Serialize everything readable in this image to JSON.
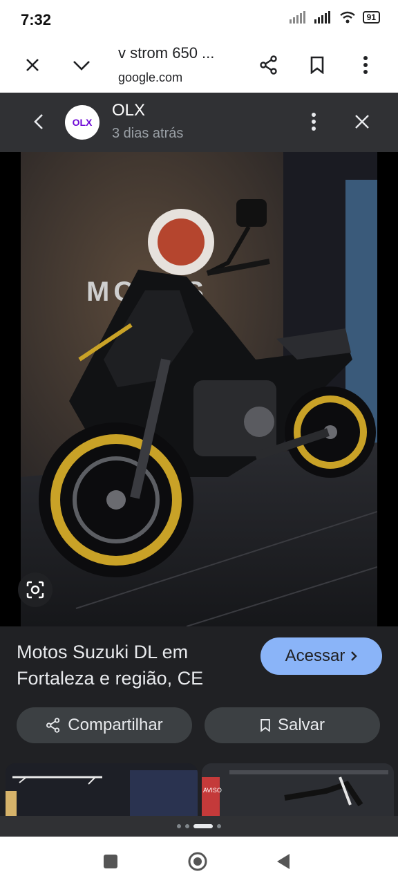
{
  "status_bar": {
    "time": "7:32",
    "battery": "91"
  },
  "browser": {
    "page_title": "v strom 650 ...",
    "domain": "google.com"
  },
  "viewer": {
    "source_logo_text": "OLX",
    "source_name": "OLX",
    "timestamp": "3 dias atrás",
    "result_title": "Motos Suzuki DL em Fortaleza e região, CE",
    "visit_label": "Acessar",
    "share_label": "Compartilhar",
    "save_label": "Salvar",
    "sign_text": "MOTOS",
    "thumbnail_2_text": "AVISO"
  },
  "colors": {
    "accent": "#8ab4f8",
    "dark_bg": "#202124",
    "header_bg": "#303134",
    "button_bg": "#3c4043",
    "olx_purple": "#6e0ad6",
    "wheel_gold": "#c9a227"
  },
  "pager": {
    "count": 4,
    "active": 2
  }
}
